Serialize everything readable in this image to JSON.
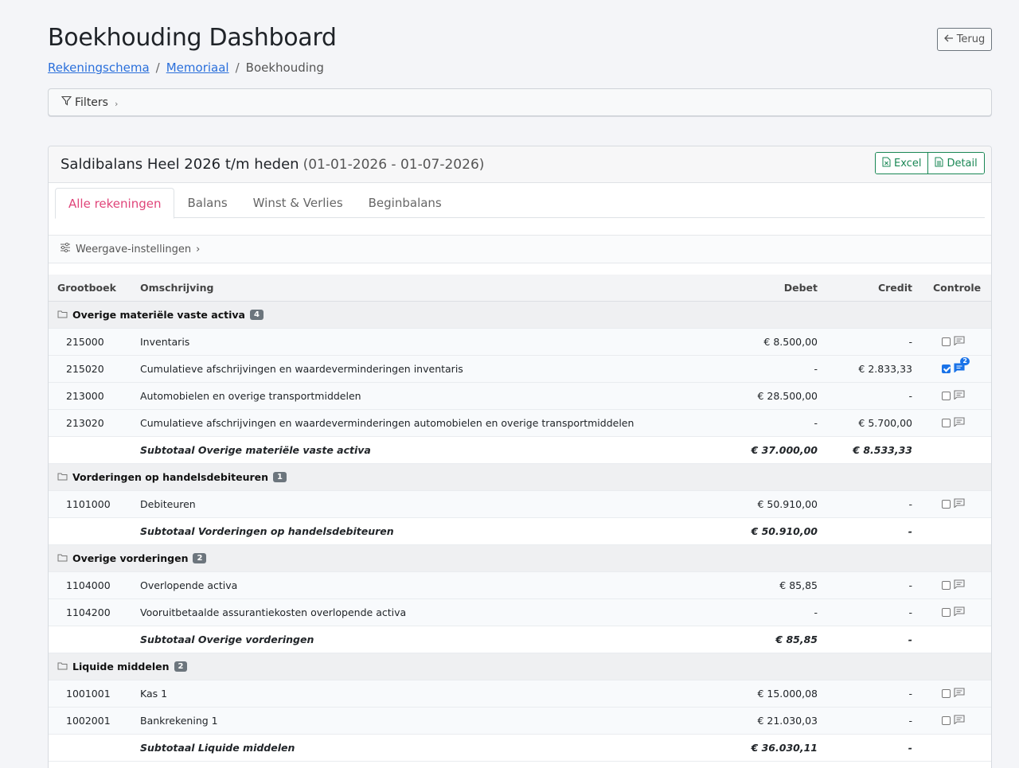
{
  "header": {
    "title": "Boekhouding Dashboard",
    "back_label": "Terug"
  },
  "breadcrumb": {
    "items": [
      "Rekeningschema",
      "Memoriaal"
    ],
    "current": "Boekhouding",
    "separator": "/"
  },
  "filters": {
    "label": "Filters"
  },
  "card": {
    "title": "Saldibalans Heel 2026 t/m heden",
    "range": "(01-01-2026 - 01-07-2026)",
    "excel_label": "Excel",
    "detail_label": "Detail"
  },
  "tabs": [
    "Alle rekeningen",
    "Balans",
    "Winst & Verlies",
    "Beginbalans"
  ],
  "view_settings": {
    "label": "Weergave-instellingen"
  },
  "table": {
    "columns": [
      "Grootboek",
      "Omschrijving",
      "Debet",
      "Credit",
      "Controle"
    ],
    "groups": [
      {
        "name": "Overige materiële vaste activa",
        "count": "4",
        "rows": [
          {
            "code": "215000",
            "desc": "Inventaris",
            "debet": "€ 8.500,00",
            "credit": "-",
            "checked": false,
            "comments": ""
          },
          {
            "code": "215020",
            "desc": "Cumulatieve afschrijvingen en waardeverminderingen inventaris",
            "debet": "-",
            "credit": "€ 2.833,33",
            "checked": true,
            "comments": "2"
          },
          {
            "code": "213000",
            "desc": "Automobielen en overige transportmiddelen",
            "debet": "€ 28.500,00",
            "credit": "-",
            "checked": false,
            "comments": ""
          },
          {
            "code": "213020",
            "desc": "Cumulatieve afschrijvingen en waardeverminderingen automobielen en overige transportmiddelen",
            "debet": "-",
            "credit": "€ 5.700,00",
            "checked": false,
            "comments": ""
          }
        ],
        "subtotal": {
          "label": "Subtotaal Overige materiële vaste activa",
          "debet": "€ 37.000,00",
          "credit": "€ 8.533,33"
        }
      },
      {
        "name": "Vorderingen op handelsdebiteuren",
        "count": "1",
        "rows": [
          {
            "code": "1101000",
            "desc": "Debiteuren",
            "debet": "€ 50.910,00",
            "credit": "-",
            "checked": false,
            "comments": ""
          }
        ],
        "subtotal": {
          "label": "Subtotaal Vorderingen op handelsdebiteuren",
          "debet": "€ 50.910,00",
          "credit": "-"
        }
      },
      {
        "name": "Overige vorderingen",
        "count": "2",
        "rows": [
          {
            "code": "1104000",
            "desc": "Overlopende activa",
            "debet": "€ 85,85",
            "credit": "-",
            "checked": false,
            "comments": ""
          },
          {
            "code": "1104200",
            "desc": "Vooruitbetaalde assurantiekosten overlopende activa",
            "debet": "-",
            "credit": "-",
            "checked": false,
            "comments": ""
          }
        ],
        "subtotal": {
          "label": "Subtotaal Overige vorderingen",
          "debet": "€ 85,85",
          "credit": "-"
        }
      },
      {
        "name": "Liquide middelen",
        "count": "2",
        "rows": [
          {
            "code": "1001001",
            "desc": "Kas 1",
            "debet": "€ 15.000,08",
            "credit": "-",
            "checked": false,
            "comments": ""
          },
          {
            "code": "1002001",
            "desc": "Bankrekening 1",
            "debet": "€ 21.030,03",
            "credit": "-",
            "checked": false,
            "comments": ""
          }
        ],
        "subtotal": {
          "label": "Subtotaal Liquide middelen",
          "debet": "€ 36.030,11",
          "credit": "-"
        }
      }
    ]
  },
  "colors": {
    "accent_tab": "#e0457a",
    "link": "#2a6fdb",
    "success": "#198754",
    "badge": "#6c757d",
    "check": "#1a73e8"
  }
}
